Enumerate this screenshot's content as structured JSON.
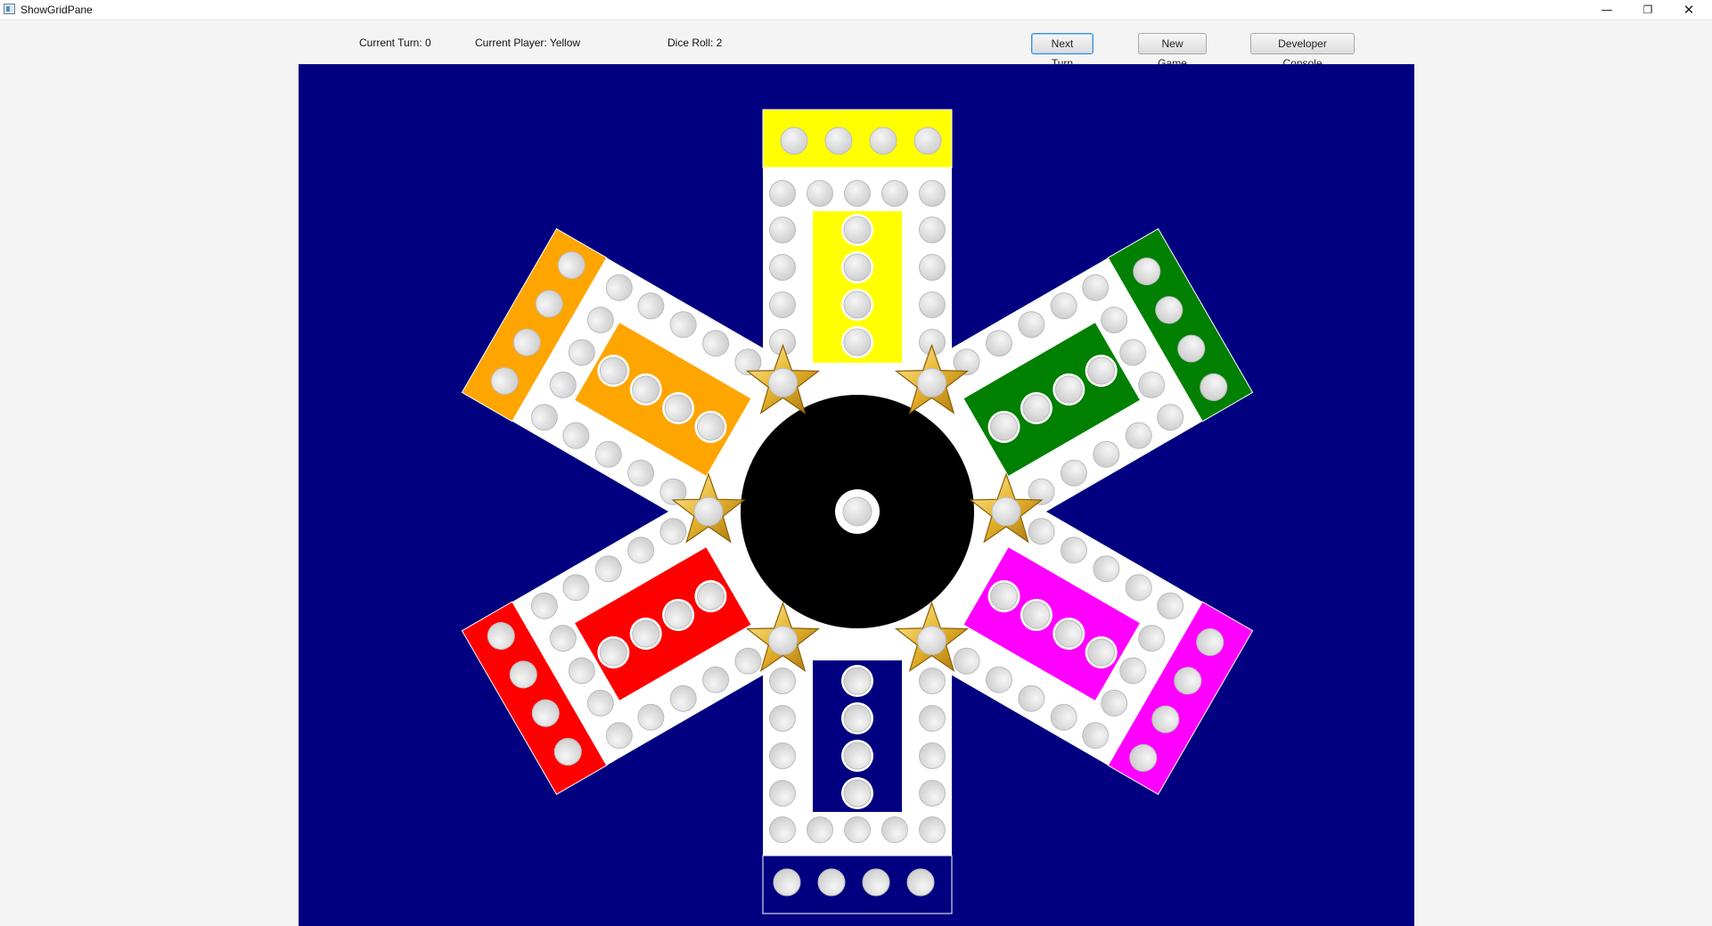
{
  "window": {
    "title": "ShowGridPane",
    "controls": {
      "minimize": "—",
      "maximize": "❐",
      "close": "✕"
    }
  },
  "toolbar": {
    "current_turn_label": "Current Turn: 0",
    "current_player_label": "Current Player: Yellow",
    "dice_roll_label": "Dice Roll: 2",
    "next_turn_button": "Next Turn",
    "new_game_button": "New Game",
    "developer_console_button": "Developer Console"
  },
  "game": {
    "current_turn": 0,
    "current_player": "Yellow",
    "dice_roll": 2,
    "board_color": "#000080",
    "track_color": "#ffffff",
    "center_color": "#000000",
    "hole_color": "#e6e6e6",
    "star_color": "#f2c640",
    "players": [
      {
        "name": "yellow",
        "color": "#ffff00",
        "home_pieces": 4,
        "finish_holes": 4
      },
      {
        "name": "green",
        "color": "#008000",
        "home_pieces": 4,
        "finish_holes": 4
      },
      {
        "name": "magenta",
        "color": "#ff00ff",
        "home_pieces": 4,
        "finish_holes": 4
      },
      {
        "name": "navy",
        "color": "#000080",
        "home_pieces": 4,
        "finish_holes": 4
      },
      {
        "name": "red",
        "color": "#ff0000",
        "home_pieces": 4,
        "finish_holes": 4
      },
      {
        "name": "orange",
        "color": "#ffa500",
        "home_pieces": 4,
        "finish_holes": 4
      }
    ]
  }
}
